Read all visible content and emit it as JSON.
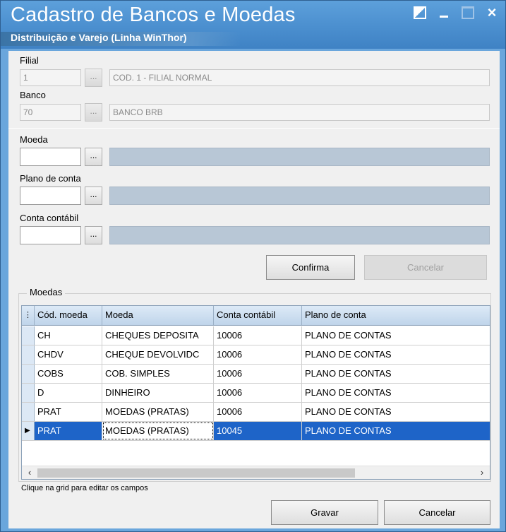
{
  "window": {
    "title": "Cadastro de Bancos e Moedas",
    "subtitle": "Distribuição e Varejo (Linha WinThor)"
  },
  "filial": {
    "label": "Filial",
    "code": "1",
    "lookup": "...",
    "description": "COD. 1 - FILIAL NORMAL"
  },
  "banco": {
    "label": "Banco",
    "code": "70",
    "lookup": "...",
    "description": "BANCO BRB"
  },
  "moeda": {
    "label": "Moeda",
    "value": "",
    "lookup": "...",
    "description": ""
  },
  "plano_conta": {
    "label": "Plano de conta",
    "value": "",
    "lookup": "...",
    "description": ""
  },
  "conta_contabil": {
    "label": "Conta contábil",
    "value": "",
    "lookup": "...",
    "description": ""
  },
  "actions": {
    "confirma": "Confirma",
    "cancelar": "Cancelar"
  },
  "moedas_group": {
    "title": "Moedas",
    "columns": [
      "Cód. moeda",
      "Moeda",
      "Conta contábil",
      "Plano de conta"
    ],
    "rows": [
      [
        "CH",
        "CHEQUES DEPOSITA",
        "10006",
        "PLANO DE CONTAS"
      ],
      [
        "CHDV",
        "CHEQUE DEVOLVIDC",
        "10006",
        "PLANO DE CONTAS"
      ],
      [
        "COBS",
        "COB. SIMPLES",
        "10006",
        "PLANO DE CONTAS"
      ],
      [
        "D",
        "DINHEIRO",
        "10006",
        "PLANO DE CONTAS"
      ],
      [
        "PRAT",
        "MOEDAS (PRATAS)",
        "10006",
        "PLANO DE CONTAS"
      ],
      [
        "PRAT",
        "MOEDAS (PRATAS)",
        "10045",
        "PLANO DE CONTAS"
      ]
    ],
    "selected_row": 5,
    "hint": "Clique na grid para editar os campos"
  },
  "footer": {
    "gravar": "Gravar",
    "cancelar": "Cancelar"
  },
  "colors": {
    "title_bar": "#4b8fcf",
    "selection": "#1e64c8",
    "window_bg": "#f0f0f0"
  }
}
